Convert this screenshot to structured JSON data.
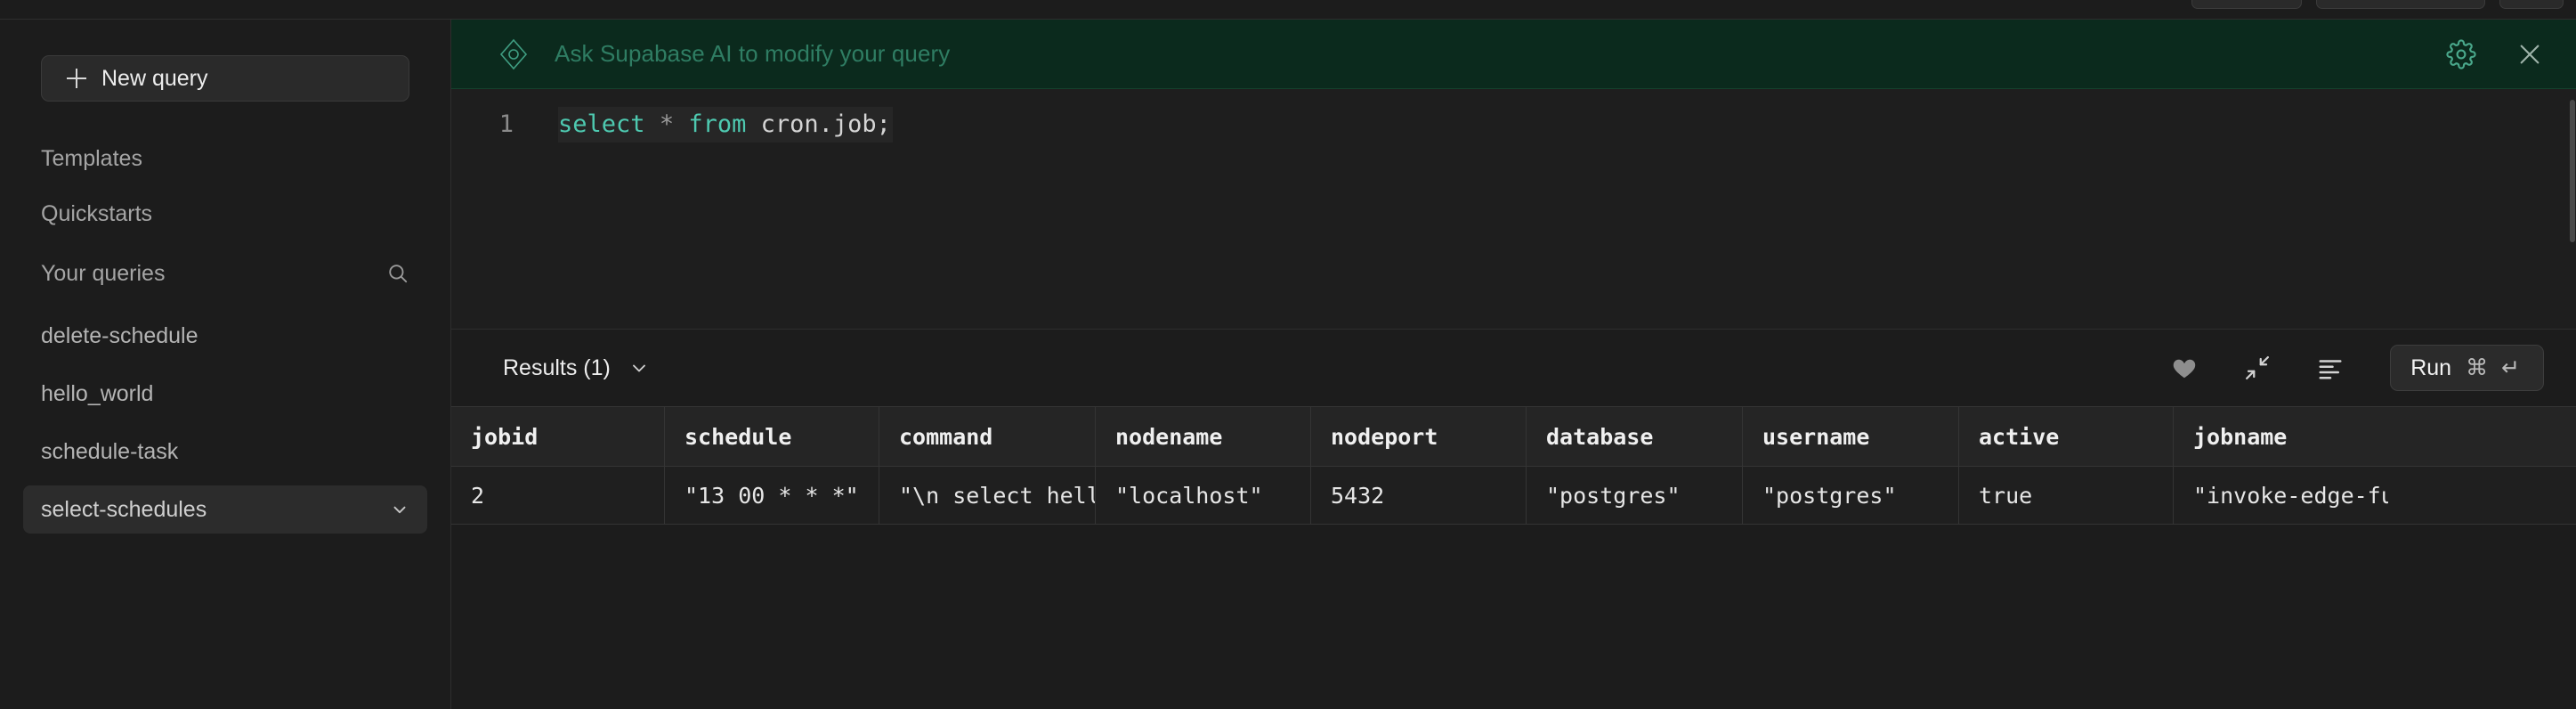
{
  "sidebar": {
    "new_query_label": "New query",
    "nav": [
      {
        "label": "Templates"
      },
      {
        "label": "Quickstarts"
      }
    ],
    "queries_section_title": "Your queries",
    "search_icon": "search-icon",
    "queries": [
      {
        "label": "delete-schedule",
        "active": false
      },
      {
        "label": "hello_world",
        "active": false
      },
      {
        "label": "schedule-task",
        "active": false
      },
      {
        "label": "select-schedules",
        "active": true
      }
    ]
  },
  "ai_bar": {
    "logo_icon": "supabase-ai-logo-icon",
    "placeholder": "Ask Supabase AI to modify your query",
    "settings_icon": "gear-icon",
    "close_icon": "close-icon",
    "accent_color": "#2f7d63",
    "background_color": "#0b2a1d"
  },
  "editor": {
    "line_number": "1",
    "sql": {
      "t1": "select",
      "t2": " ",
      "t3": "*",
      "t4": " ",
      "t5": "from",
      "t6": " cron.job;"
    },
    "full_text": "select * from cron.job;"
  },
  "results_toolbar": {
    "results_label": "Results (1)",
    "chevron_icon": "chevron-down-icon",
    "favorite_icon": "heart-icon",
    "collapse_icon": "collapse-icon",
    "format_icon": "format-sql-icon",
    "run_label": "Run",
    "run_shortcut": "⌘ ↵"
  },
  "results_grid": {
    "columns": [
      "jobid",
      "schedule",
      "command",
      "nodename",
      "nodeport",
      "database",
      "username",
      "active",
      "jobname"
    ],
    "rows": [
      {
        "jobid": "2",
        "schedule": "\"13 00 * * *\"",
        "command": "\"\\n select hello",
        "nodename": "\"localhost\"",
        "nodeport": "5432",
        "database": "\"postgres\"",
        "username": "\"postgres\"",
        "active": "true",
        "jobname": "\"invoke-edge-fun"
      }
    ]
  }
}
